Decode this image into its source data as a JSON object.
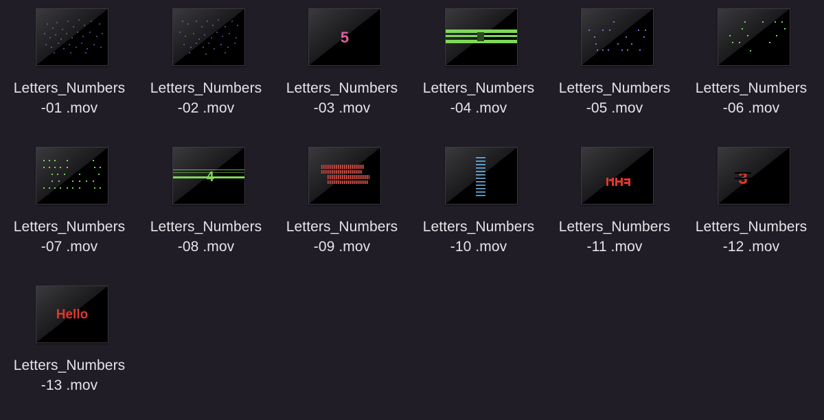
{
  "files": [
    {
      "name_line1": "Letters_Numbers",
      "name_line2": "-01 .mov",
      "thumb_icon": "purple-dots-grid"
    },
    {
      "name_line1": "Letters_Numbers",
      "name_line2": "-02 .mov",
      "thumb_icon": "purple-dots-grid"
    },
    {
      "name_line1": "Letters_Numbers",
      "name_line2": "-03 .mov",
      "thumb_icon": "pink-digit",
      "thumb_text": "5"
    },
    {
      "name_line1": "Letters_Numbers",
      "name_line2": "-04 .mov",
      "thumb_icon": "green-bars-digit"
    },
    {
      "name_line1": "Letters_Numbers",
      "name_line2": "-05 .mov",
      "thumb_icon": "purple-letters-scatter"
    },
    {
      "name_line1": "Letters_Numbers",
      "name_line2": "-06 .mov",
      "thumb_icon": "green-digits-scatter"
    },
    {
      "name_line1": "Letters_Numbers",
      "name_line2": "-07 .mov",
      "thumb_icon": "green-letters-grid"
    },
    {
      "name_line1": "Letters_Numbers",
      "name_line2": "-08 .mov",
      "thumb_icon": "green-line-digit",
      "thumb_text": "4"
    },
    {
      "name_line1": "Letters_Numbers",
      "name_line2": "-09 .mov",
      "thumb_icon": "red-striped-blocks"
    },
    {
      "name_line1": "Letters_Numbers",
      "name_line2": "-10 .mov",
      "thumb_icon": "blue-text-column"
    },
    {
      "name_line1": "Letters_Numbers",
      "name_line2": "-11 .mov",
      "thumb_icon": "red-glitch-text"
    },
    {
      "name_line1": "Letters_Numbers",
      "name_line2": "-12 .mov",
      "thumb_icon": "red-glitch-digit",
      "thumb_text": "3"
    },
    {
      "name_line1": "Letters_Numbers",
      "name_line2": "-13 .mov",
      "thumb_icon": "red-glow-word",
      "thumb_text": "Hello"
    }
  ],
  "colors": {
    "background": "#201d26",
    "label_text": "#e6e4e9",
    "thumb_bg": "#000000",
    "purple": "#8b6bd9",
    "pink": "#e0629a",
    "green": "#7ed957",
    "blue": "#6fb6e8",
    "red": "#e0382e"
  }
}
